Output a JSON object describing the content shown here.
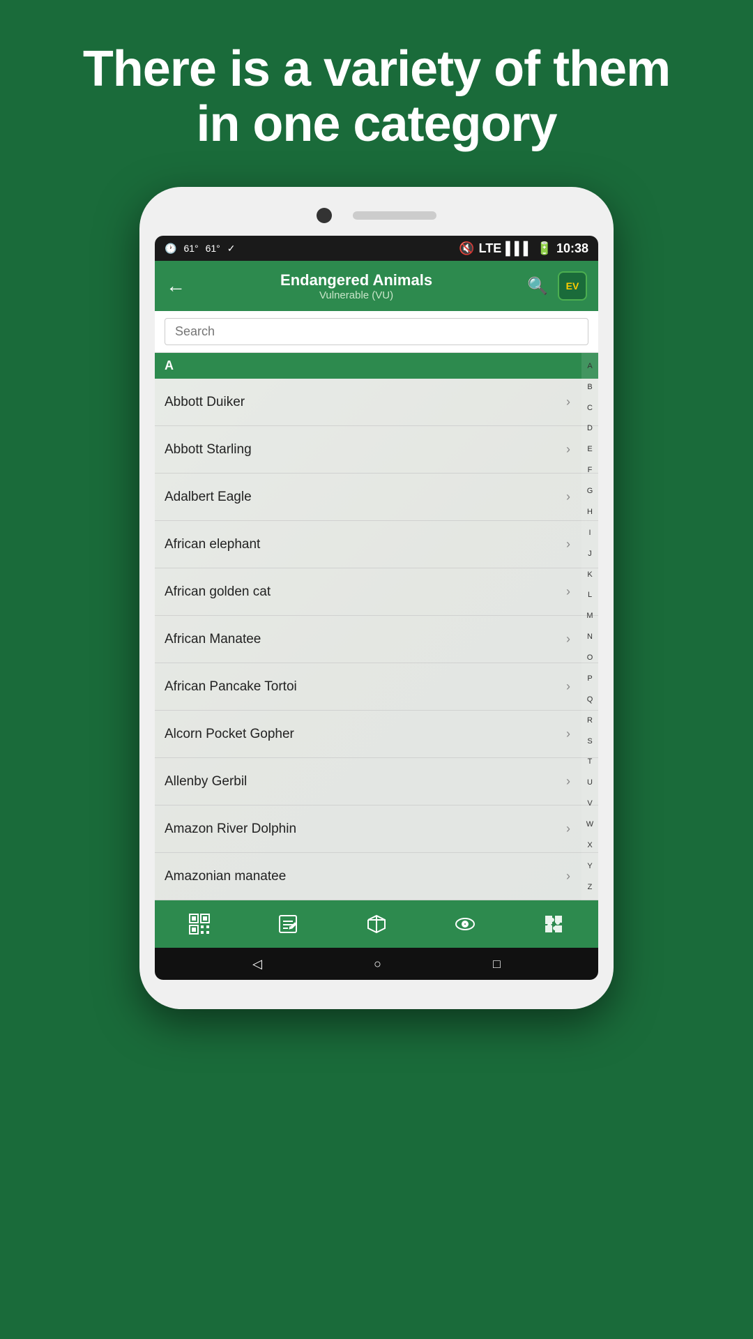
{
  "page": {
    "header_text": "There is a variety of them in one category"
  },
  "status_bar": {
    "left": [
      "☺",
      "61°",
      "61°",
      "✓"
    ],
    "time": "10:38"
  },
  "toolbar": {
    "title": "Endangered Animals",
    "subtitle": "Vulnerable (VU)",
    "back_label": "←",
    "logo_text": "EV"
  },
  "search": {
    "placeholder": "Search"
  },
  "section_header": "A",
  "animals": [
    {
      "name": "Abbott Duiker"
    },
    {
      "name": "Abbott Starling"
    },
    {
      "name": "Adalbert Eagle"
    },
    {
      "name": "African elephant"
    },
    {
      "name": "African golden cat"
    },
    {
      "name": "African Manatee"
    },
    {
      "name": "African Pancake Tortoi"
    },
    {
      "name": "Alcorn Pocket Gopher"
    },
    {
      "name": "Allenby Gerbil"
    },
    {
      "name": "Amazon River Dolphin"
    },
    {
      "name": "Amazonian manatee"
    }
  ],
  "alphabet": [
    "A",
    "B",
    "C",
    "D",
    "E",
    "F",
    "G",
    "H",
    "I",
    "J",
    "K",
    "L",
    "M",
    "N",
    "O",
    "P",
    "Q",
    "R",
    "S",
    "T",
    "U",
    "V",
    "W",
    "X",
    "Y",
    "Z"
  ],
  "bottom_nav": {
    "icons": [
      "qr-icon",
      "edit-icon",
      "box-icon",
      "eye-icon",
      "puzzle-icon"
    ]
  },
  "android_nav": {
    "back": "◁",
    "home": "○",
    "recent": "□"
  }
}
